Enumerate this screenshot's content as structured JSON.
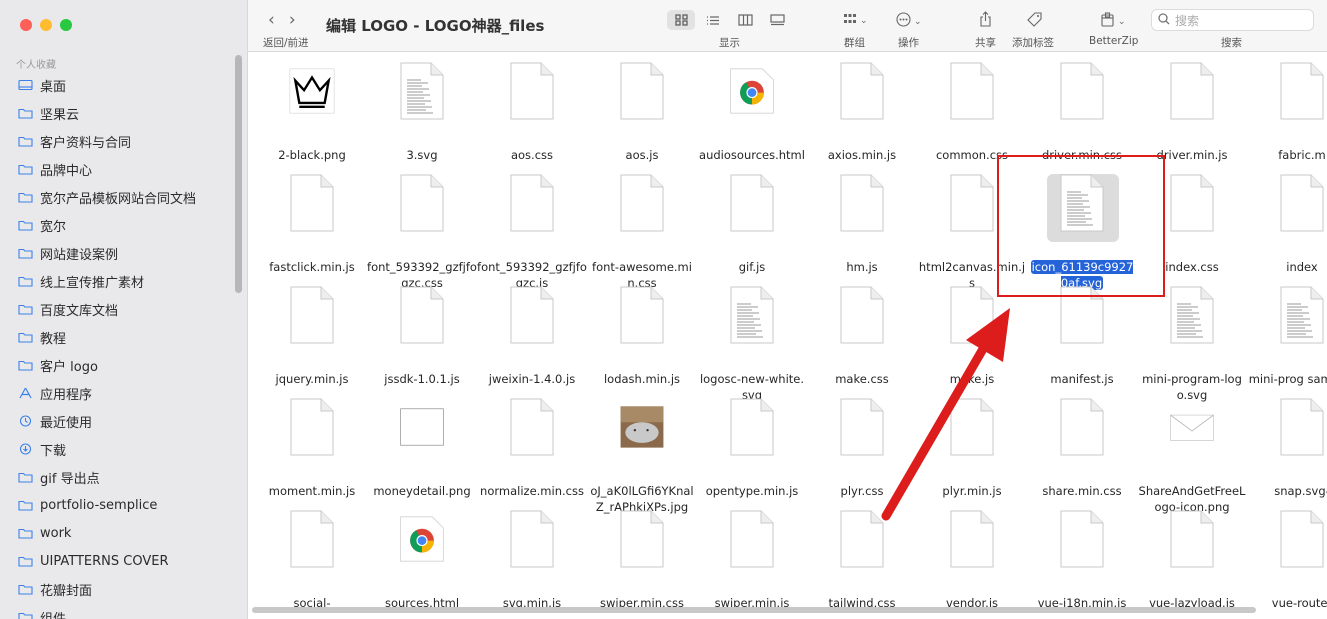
{
  "window": {
    "title": "编辑 LOGO - LOGO神器_files"
  },
  "sidebar": {
    "section_title": "个人收藏",
    "items": [
      {
        "label": "桌面",
        "icon": "desktop-icon"
      },
      {
        "label": "坚果云",
        "icon": "folder-icon"
      },
      {
        "label": "客户资料与合同",
        "icon": "folder-icon"
      },
      {
        "label": "品牌中心",
        "icon": "folder-icon"
      },
      {
        "label": "宽尔产品模板网站合同文档",
        "icon": "folder-icon"
      },
      {
        "label": "宽尔",
        "icon": "folder-icon"
      },
      {
        "label": "网站建设案例",
        "icon": "folder-icon"
      },
      {
        "label": "线上宣传推广素材",
        "icon": "folder-icon"
      },
      {
        "label": "百度文库文档",
        "icon": "folder-icon"
      },
      {
        "label": "教程",
        "icon": "folder-icon"
      },
      {
        "label": "客户 logo",
        "icon": "folder-icon"
      },
      {
        "label": "应用程序",
        "icon": "applications-icon"
      },
      {
        "label": "最近使用",
        "icon": "clock-icon"
      },
      {
        "label": "下载",
        "icon": "download-icon"
      },
      {
        "label": "gif 导出点",
        "icon": "folder-icon"
      },
      {
        "label": "portfolio-semplice",
        "icon": "folder-icon"
      },
      {
        "label": "work",
        "icon": "folder-icon"
      },
      {
        "label": "UIPATTERNS COVER",
        "icon": "folder-icon"
      },
      {
        "label": "花瓣封面",
        "icon": "folder-icon"
      },
      {
        "label": "组件",
        "icon": "folder-icon"
      }
    ]
  },
  "toolbar": {
    "back_forward_label": "返回/前进",
    "view_label": "显示",
    "group_label": "群组",
    "action_label": "操作",
    "share_label": "共享",
    "tag_label": "添加标签",
    "betterzip_label": "BetterZip",
    "search_label": "搜索",
    "search_placeholder": "搜索"
  },
  "files": [
    {
      "name": "2-black.png",
      "kind": "crown"
    },
    {
      "name": "3.svg",
      "kind": "textdoc"
    },
    {
      "name": "aos.css",
      "kind": "blank"
    },
    {
      "name": "aos.js",
      "kind": "blank"
    },
    {
      "name": "audiosources.html",
      "kind": "chrome"
    },
    {
      "name": "axios.min.js",
      "kind": "blank"
    },
    {
      "name": "common.css",
      "kind": "blank"
    },
    {
      "name": "driver.min.css",
      "kind": "blank"
    },
    {
      "name": "driver.min.js",
      "kind": "blank"
    },
    {
      "name": "fabric.m",
      "kind": "blank"
    },
    {
      "name": "fastclick.min.js",
      "kind": "blank"
    },
    {
      "name": "font_593392_gzfjfoqzc.css",
      "kind": "blank"
    },
    {
      "name": "font_593392_gzfjfoqzc.js",
      "kind": "blank"
    },
    {
      "name": "font-awesome.min.css",
      "kind": "blank"
    },
    {
      "name": "gif.js",
      "kind": "blank"
    },
    {
      "name": "hm.js",
      "kind": "blank"
    },
    {
      "name": "html2canvas.min.js",
      "kind": "blank"
    },
    {
      "name": "icon_61139c99270af.svg",
      "kind": "textdoc",
      "selected": true
    },
    {
      "name": "index.css",
      "kind": "blank"
    },
    {
      "name": "index",
      "kind": "blank"
    },
    {
      "name": "jquery.min.js",
      "kind": "blank"
    },
    {
      "name": "jssdk-1.0.1.js",
      "kind": "blank"
    },
    {
      "name": "jweixin-1.4.0.js",
      "kind": "blank"
    },
    {
      "name": "lodash.min.js",
      "kind": "blank"
    },
    {
      "name": "logosc-new-white.svg",
      "kind": "textdoc"
    },
    {
      "name": "make.css",
      "kind": "blank"
    },
    {
      "name": "make.js",
      "kind": "blank"
    },
    {
      "name": "manifest.js",
      "kind": "blank"
    },
    {
      "name": "mini-program-logo.svg",
      "kind": "textdoc"
    },
    {
      "name": "mini-prog samples",
      "kind": "textdoc"
    },
    {
      "name": "moment.min.js",
      "kind": "blank"
    },
    {
      "name": "moneydetail.png",
      "kind": "frame"
    },
    {
      "name": "normalize.min.css",
      "kind": "blank"
    },
    {
      "name": "oJ_aK0lLGfi6YKnalZ_rAPhkiXPs.jpg",
      "kind": "photo"
    },
    {
      "name": "opentype.min.js",
      "kind": "blank"
    },
    {
      "name": "plyr.css",
      "kind": "blank"
    },
    {
      "name": "plyr.min.js",
      "kind": "blank"
    },
    {
      "name": "share.min.css",
      "kind": "blank"
    },
    {
      "name": "ShareAndGetFreeLogo-icon.png",
      "kind": "envelope"
    },
    {
      "name": "snap.svg-",
      "kind": "blank"
    },
    {
      "name": "social-",
      "kind": "blank"
    },
    {
      "name": "sources.html",
      "kind": "chrome"
    },
    {
      "name": "svg.min.js",
      "kind": "blank"
    },
    {
      "name": "swiper.min.css",
      "kind": "blank"
    },
    {
      "name": "swiper.min.js",
      "kind": "blank"
    },
    {
      "name": "tailwind.css",
      "kind": "blank"
    },
    {
      "name": "vendor.js",
      "kind": "blank"
    },
    {
      "name": "vue-i18n.min.js",
      "kind": "blank"
    },
    {
      "name": "vue-lazyload.js",
      "kind": "blank"
    },
    {
      "name": "vue-router",
      "kind": "blank"
    }
  ],
  "colors": {
    "accent": "#2563d8",
    "annotation": "#dd1c1c"
  }
}
